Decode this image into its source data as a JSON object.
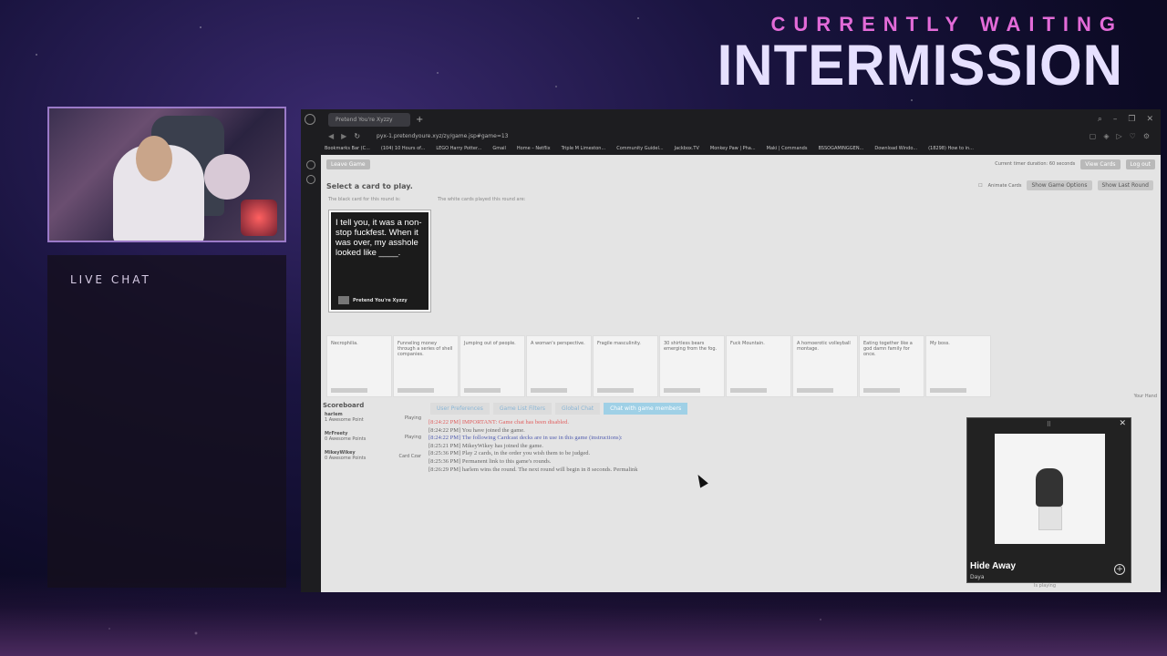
{
  "overlay": {
    "subtitle": "CURRENTLY WAITING",
    "title": "INTERMISSION"
  },
  "chat": {
    "title": "LIVE CHAT"
  },
  "browser": {
    "tab_title": "Pretend You're Xyzzy",
    "url": "pyx-1.pretendyoure.xyz/zy/game.jsp#game=13",
    "bookmarks": [
      "Bookmarks Bar (C...",
      "(104) 10 Hours of...",
      "LEGO Harry Potter...",
      "Gmail",
      "Home – Netflix",
      "Triple M Limeston...",
      "Community Guidel...",
      "Jackbox.TV",
      "Monkey Paw | Pha...",
      "Maki | Commands",
      "BSSOGAMINGGEN...",
      "Download Windo...",
      "(18298) How to in..."
    ]
  },
  "game": {
    "leave_label": "Leave Game",
    "timer_text": "Current timer duration: 60 seconds",
    "view_cards_label": "View Cards",
    "logout_label": "Log out",
    "select_title": "Select a card to play.",
    "anim_label": "Animate Cards",
    "show_options_label": "Show Game Options",
    "show_last_round_label": "Show Last Round",
    "black_caption": "The black card for this round is:",
    "white_caption": "The white cards played this round are:",
    "black_card_text": "I tell you, it was a non-stop fuckfest. When it was over, my asshole looked like ____.",
    "card_footer": "Pretend You're Xyzzy",
    "hand": [
      "Necrophilia.",
      "Funneling money through a series of shell companies.",
      "Jumping out of people.",
      "A woman's perspective.",
      "Fragile masculinity.",
      "30 shirtless bears emerging from the fog.",
      "Fuck Mountain.",
      "A homoerotic volleyball montage.",
      "Eating together like a god damn family for once.",
      "My boss."
    ],
    "your_hand": "Your Hand",
    "scoreboard_title": "Scoreboard",
    "players": [
      {
        "name": "harlem",
        "score": "1 Awesome Point",
        "status": "Playing"
      },
      {
        "name": "MrFreety",
        "score": "0 Awesome Points",
        "status": "Playing"
      },
      {
        "name": "MikeyWikey",
        "score": "0 Awesome Points",
        "status": "Card Czar"
      }
    ],
    "tabs": [
      "User Preferences",
      "Game List Filters",
      "Global Chat",
      "Chat with game members"
    ],
    "log": [
      {
        "text": "[8:24:22 PM] IMPORTANT: Game chat has been disabled.",
        "style": "red"
      },
      {
        "text": "[8:24:22 PM] You have joined the game.",
        "style": "normal"
      },
      {
        "text": "[8:24:22 PM] The following Cardcast decks are in use in this game (instructions):",
        "style": "blue"
      },
      {
        "text": "[8:25:21 PM] MikeyWikey has joined the game.",
        "style": "normal"
      },
      {
        "text": "[8:25:36 PM] Play 2 cards, in the order you wish them to be judged.",
        "style": "normal"
      },
      {
        "text": "[8:25:36 PM] Permanent link to this game's rounds.",
        "style": "normal"
      },
      {
        "text": "[8:26:29 PM] harlem wins the round. The next round will begin in 8 seconds. Permalink",
        "style": "normal"
      }
    ]
  },
  "miniplayer": {
    "song": "Hide Away",
    "artist": "Daya",
    "status": "Is playing"
  }
}
